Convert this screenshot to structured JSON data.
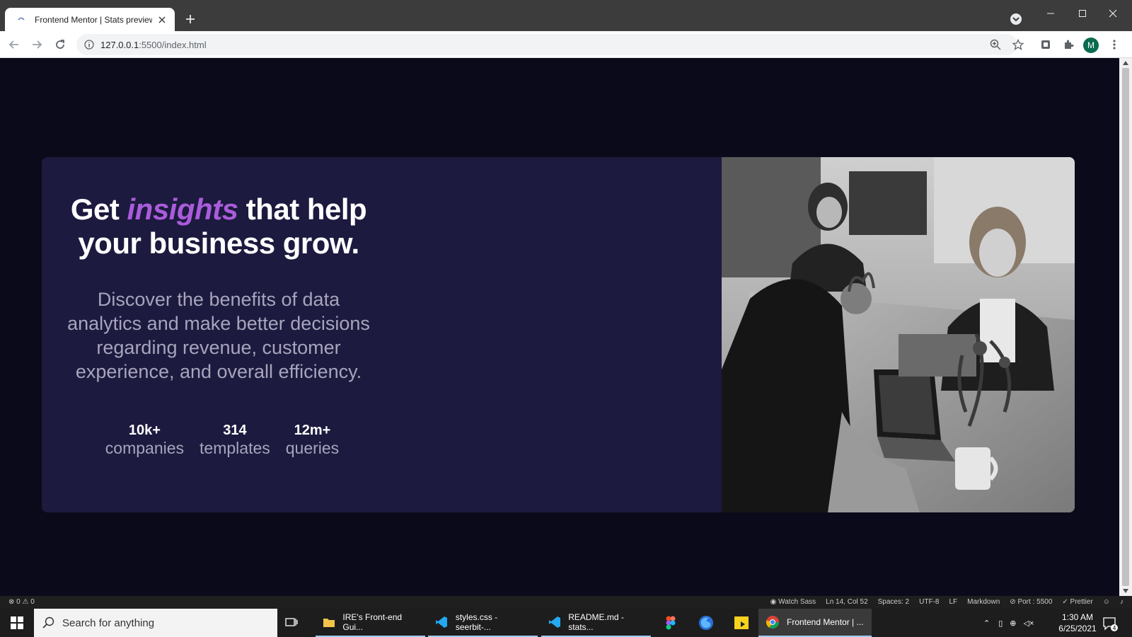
{
  "browser": {
    "tab_title": "Frontend Mentor | Stats preview",
    "url_host": "127.0.0.1",
    "url_rest": ":5500/index.html",
    "avatar_letter": "M"
  },
  "page": {
    "heading_before": "Get",
    "heading_accent": "insights",
    "heading_after": "that help your business grow.",
    "description": "Discover the benefits of data analytics and make better decisions regarding revenue, customer experience, and overall efficiency.",
    "stats": [
      {
        "value": "10k+",
        "label": "companies"
      },
      {
        "value": "314",
        "label": "templates"
      },
      {
        "value": "12m+",
        "label": "queries"
      }
    ],
    "colors": {
      "background": "#0b0a1a",
      "card": "#1c1a3e",
      "accent": "#aa5cdb",
      "text_muted": "#a7a4bd"
    }
  },
  "statusbar": {
    "problems": "0",
    "warnings": "0",
    "items": [
      "Watch Sass",
      "Ln 14, Col 52",
      "Spaces: 2",
      "UTF-8",
      "LF",
      "Markdown",
      "Port : 5500",
      "Prettier"
    ]
  },
  "taskbar": {
    "search_placeholder": "Search for anything",
    "apps": [
      {
        "label": "IRE's Front-end Gui...",
        "icon": "folder-icon"
      },
      {
        "label": "styles.css - seerbit-...",
        "icon": "vscode-icon"
      },
      {
        "label": "README.md - stats...",
        "icon": "vscode-icon"
      },
      {
        "label": "Frontend Mentor | ...",
        "icon": "chrome-icon"
      }
    ],
    "time": "1:30 AM",
    "date": "6/25/2021",
    "notifications": "4"
  }
}
